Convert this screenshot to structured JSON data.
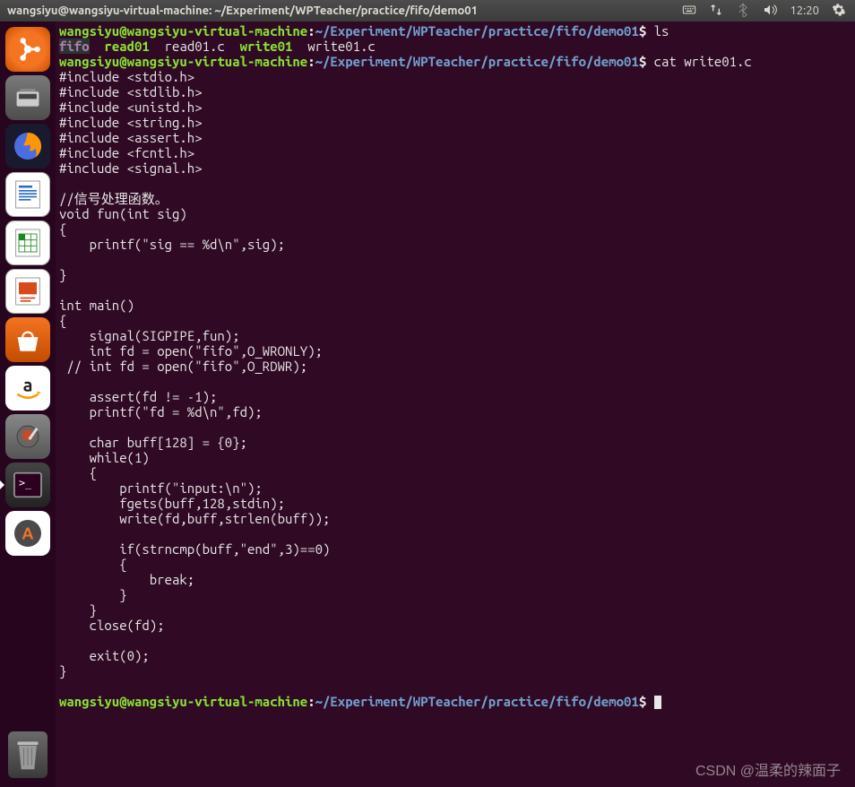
{
  "topbar": {
    "title": "wangsiyu@wangsiyu-virtual-machine: ~/Experiment/WPTeacher/practice/fifo/demo01",
    "clock": "12:20"
  },
  "prompt": {
    "user": "wangsiyu@wangsiyu-virtual-machine",
    "sep1": ":",
    "path": "~/Experiment/WPTeacher/practice/fifo/demo01",
    "sep2": "$"
  },
  "cmd": {
    "ls": " ls",
    "cat": " cat write01.c"
  },
  "ls": {
    "fifo": "fifo",
    "read01": "read01",
    "read01c": "read01.c",
    "write01": "write01",
    "write01c": "write01.c"
  },
  "code": "#include <stdio.h>\n#include <stdlib.h>\n#include <unistd.h>\n#include <string.h>\n#include <assert.h>\n#include <fcntl.h>\n#include <signal.h>\n\n//信号处理函数。\nvoid fun(int sig)\n{\n    printf(\"sig == %d\\n\",sig);\n\n}\n\nint main()\n{\n    signal(SIGPIPE,fun);\n    int fd = open(\"fifo\",O_WRONLY);\n // int fd = open(\"fifo\",O_RDWR);\n\n    assert(fd != -1);\n    printf(\"fd = %d\\n\",fd);\n\n    char buff[128] = {0};\n    while(1)\n    {\n        printf(\"input:\\n\");\n        fgets(buff,128,stdin);\n        write(fd,buff,strlen(buff));\n\n        if(strncmp(buff,\"end\",3)==0)\n        {\n            break;\n        }\n    }\n    close(fd);\n\n    exit(0);\n}\n",
  "watermark": "CSDN @温柔的辣面子"
}
